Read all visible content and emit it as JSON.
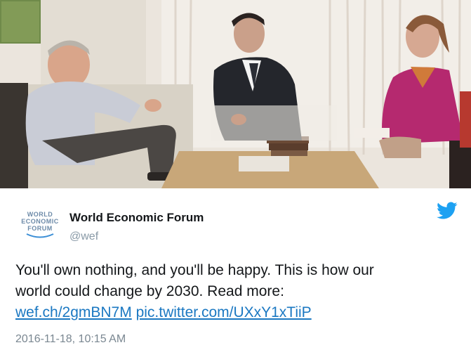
{
  "photo": {
    "alt_description": ""
  },
  "author": {
    "logo_lines": [
      "WORLD",
      "ECONOMIC",
      "FORUM"
    ],
    "name": "World Economic Forum",
    "handle": "@wef"
  },
  "icons": {
    "brand": "twitter-bird-icon",
    "brand_color": "#1da1f2"
  },
  "tweet": {
    "line1": "You'll own nothing, and you'll be happy. This is how our",
    "line2": "world could change by 2030. Read more:",
    "link1": "wef.ch/2gmBN7M",
    "link2": "pic.twitter.com/UXxY1xTiiP",
    "link_color": "#1b78c2",
    "timestamp": "2016-11-18, 10:15 AM"
  }
}
